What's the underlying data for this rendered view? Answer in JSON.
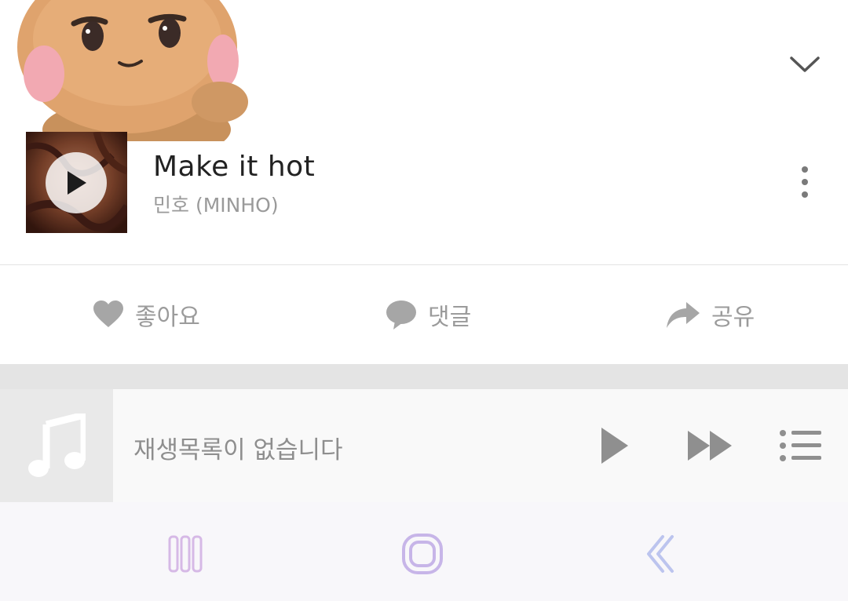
{
  "header": {
    "collapse_icon": "chevron-down-icon",
    "notification_dot_color": "#e8141e"
  },
  "song": {
    "title": "Make it hot",
    "artist": "민호 (MINHO)",
    "more_icon": "more-vertical-icon",
    "cover_play_icon": "play-icon"
  },
  "actions": [
    {
      "label": "좋아요",
      "icon": "heart-icon"
    },
    {
      "label": "댓글",
      "icon": "comment-icon"
    },
    {
      "label": "공유",
      "icon": "share-icon"
    }
  ],
  "player": {
    "message": "재생목록이 없습니다",
    "thumb_icon": "music-note-icon",
    "play_icon": "play-icon",
    "next_icon": "fast-forward-icon",
    "playlist_icon": "playlist-icon"
  },
  "navbar": {
    "recent_icon": "recent-apps-icon",
    "home_icon": "home-icon",
    "back_icon": "back-icon",
    "accent_color": "#c9b6e6"
  }
}
